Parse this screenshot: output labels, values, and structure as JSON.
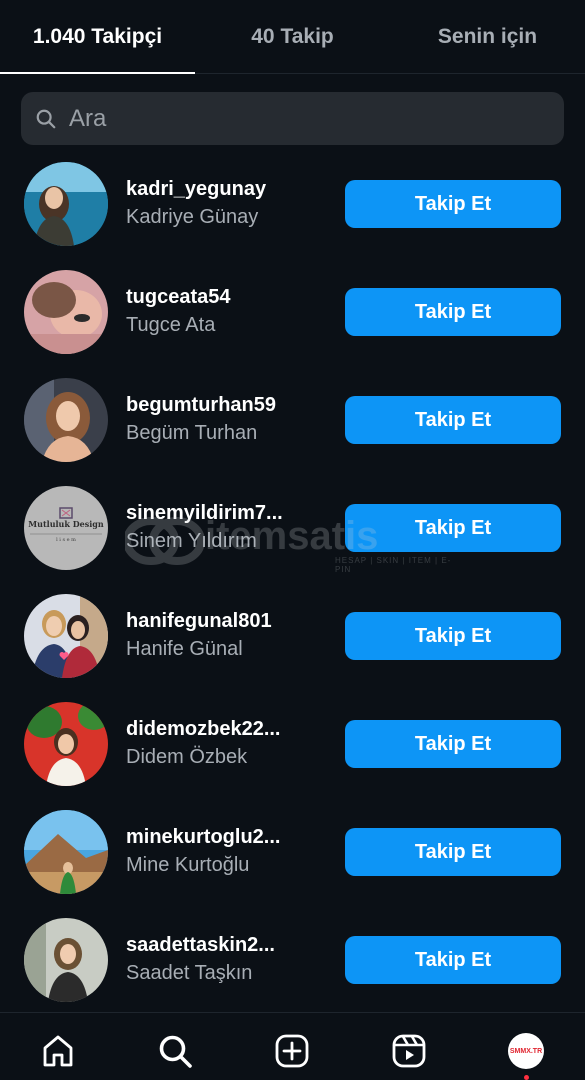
{
  "tabs": [
    {
      "label": "1.040 Takipçi",
      "active": true
    },
    {
      "label": "40 Takip",
      "active": false
    },
    {
      "label": "Senin için",
      "active": false
    }
  ],
  "search": {
    "placeholder": "Ara"
  },
  "follow_label": "Takip Et",
  "followers": [
    {
      "username": "kadri_yegunay",
      "name": "Kadriye Günay"
    },
    {
      "username": "tugceata54",
      "name": "Tugce Ata"
    },
    {
      "username": "begumturhan59",
      "name": "Begüm Turhan"
    },
    {
      "username": "sinemyildirim7...",
      "name": "Sinem Yıldırım",
      "avatar_text": "Mutluluk Design",
      "avatar_subtext": "l i s e m"
    },
    {
      "username": "hanifegunal801",
      "name": "Hanife Günal"
    },
    {
      "username": "didemozbek22...",
      "name": "Didem Özbek"
    },
    {
      "username": "minekurtoglu2...",
      "name": "Mine Kurtoğlu"
    },
    {
      "username": "saadettaskin2...",
      "name": "Saadet Taşkın"
    }
  ],
  "watermark": {
    "text": "itemsatis",
    "sub": "HESAP | SKIN | ITEM | E-PIN",
    "domain": ".com"
  },
  "nav": {
    "items": [
      "home-icon",
      "search-icon",
      "create-icon",
      "reels-icon",
      "profile-avatar"
    ],
    "profile_badge": "SMMX.TR"
  },
  "colors": {
    "background": "#0b1016",
    "follow_button": "#0d95f6",
    "search_bg": "#262b31",
    "secondary_text": "#a8aeb5"
  }
}
